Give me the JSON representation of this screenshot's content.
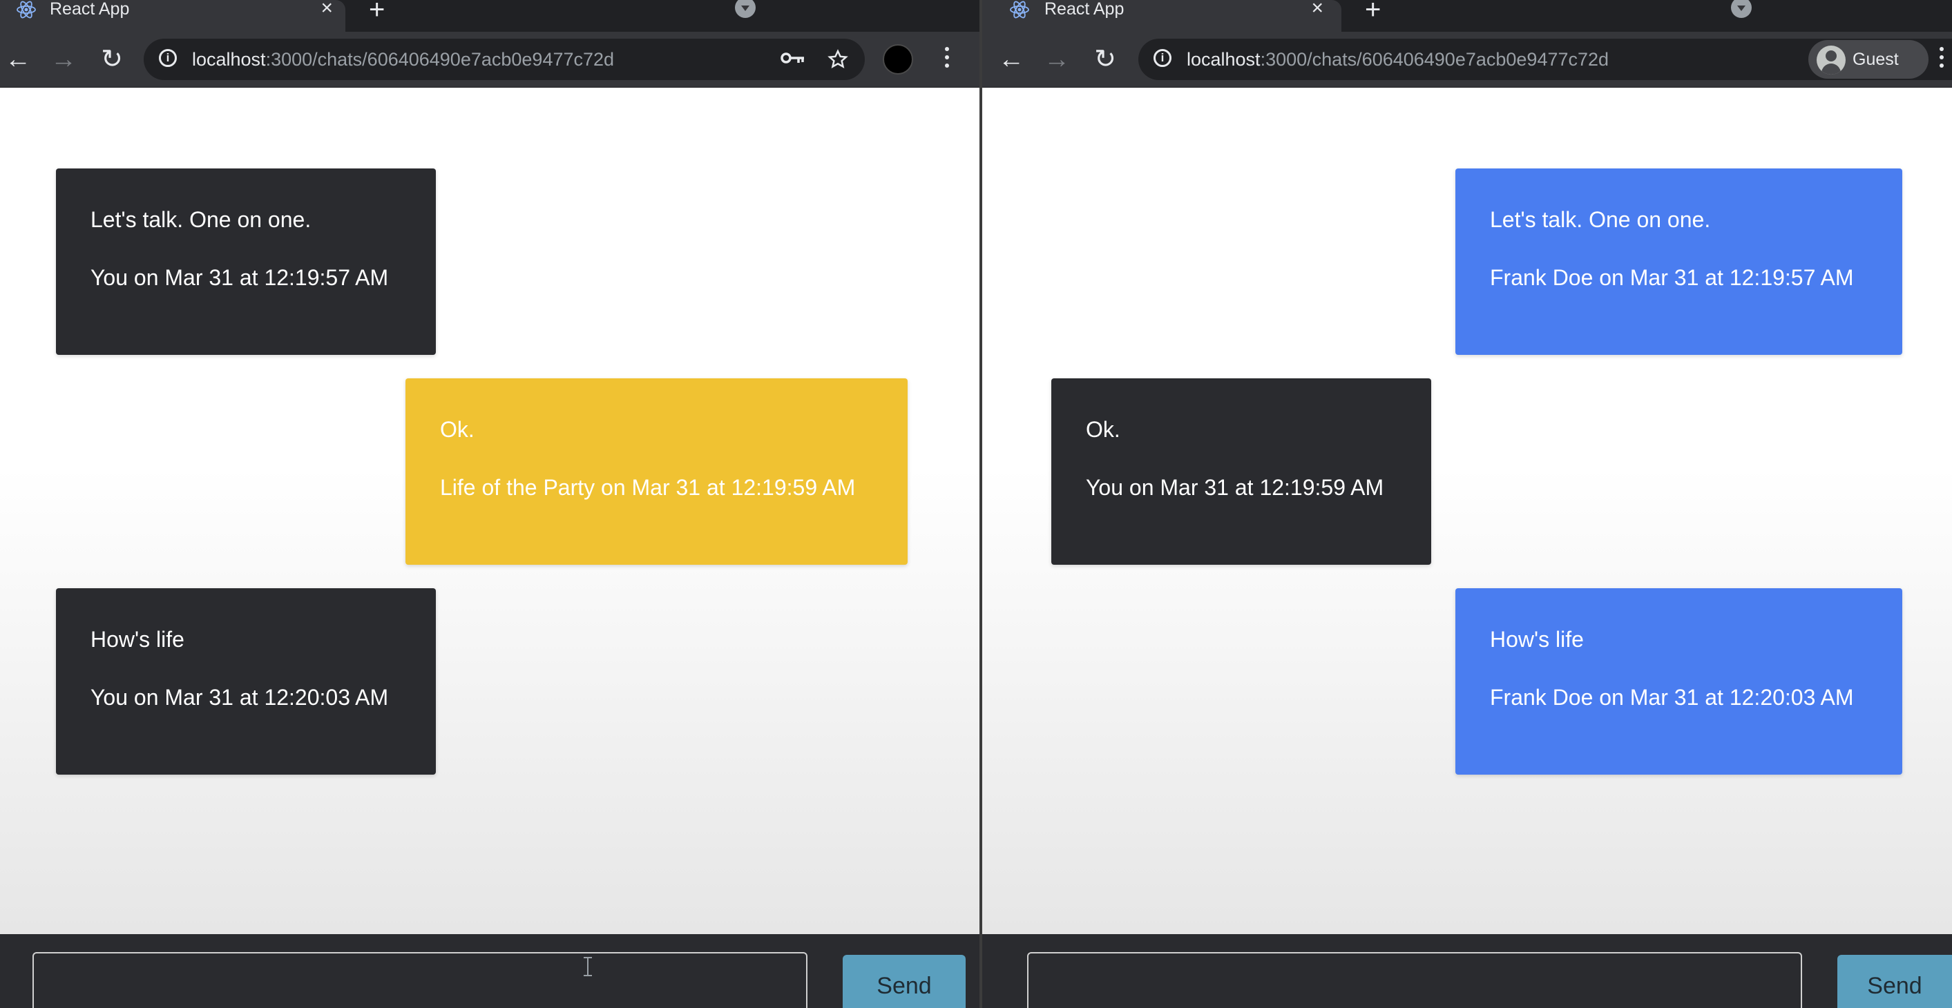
{
  "left_window": {
    "tab": {
      "title": "React App",
      "close_label": "×",
      "new_tab_label": "+",
      "favicon": "react-icon"
    },
    "toolbar": {
      "back_label": "←",
      "forward_label": "→",
      "reload_label": "↻",
      "url_host": "localhost",
      "url_path": ":3000/chats/606406490e7acb0e9477c72d",
      "key_icon": "key-icon",
      "star_icon": "star-icon",
      "profile": "profile-avatar"
    },
    "messages": [
      {
        "text": "Let's talk. One on one.",
        "meta": "You on Mar 31 at 12:19:57 AM",
        "color": "#2a2b2f"
      },
      {
        "text": "Ok.",
        "meta": "Life of the Party on Mar 31 at 12:19:59 AM",
        "color": "#f0c232"
      },
      {
        "text": "How's life",
        "meta": "You on Mar 31 at 12:20:03 AM",
        "color": "#2a2b2f"
      }
    ],
    "composer": {
      "input_value": "",
      "send_label": "Send"
    }
  },
  "right_window": {
    "tab": {
      "title": "React App",
      "close_label": "×",
      "new_tab_label": "+",
      "favicon": "react-icon"
    },
    "toolbar": {
      "back_label": "←",
      "forward_label": "→",
      "reload_label": "↻",
      "url_host": "localhost",
      "url_path": ":3000/chats/606406490e7acb0e9477c72d",
      "profile_label": "Guest"
    },
    "messages": [
      {
        "text": "Let's talk. One on one.",
        "meta": "Frank Doe on Mar 31 at 12:19:57 AM",
        "color": "#4a7df0"
      },
      {
        "text": "Ok.",
        "meta": "You on Mar 31 at 12:19:59 AM",
        "color": "#2a2b2f"
      },
      {
        "text": "How's life",
        "meta": "Frank Doe on Mar 31 at 12:20:03 AM",
        "color": "#4a7df0"
      }
    ],
    "composer": {
      "input_value": "",
      "send_label": "Send"
    }
  }
}
